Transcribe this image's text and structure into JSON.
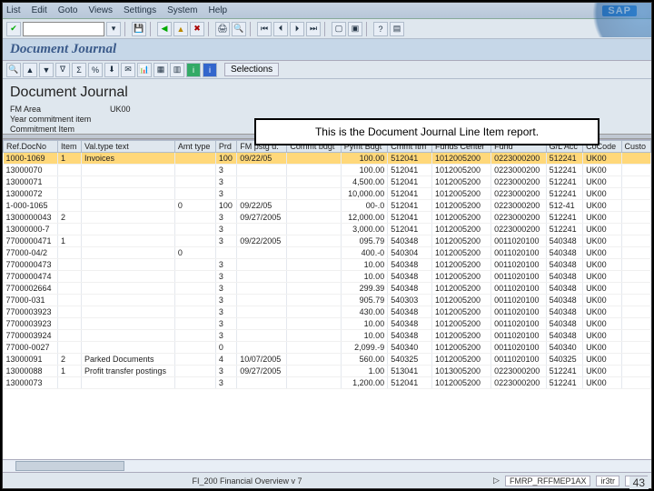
{
  "menu": [
    "List",
    "Edit",
    "Goto",
    "Views",
    "Settings",
    "System",
    "Help"
  ],
  "logo": "SAP",
  "transaction_input": "",
  "title": "Document Journal",
  "page_heading": "Document Journal",
  "header": {
    "fm_area_label": "FM Area",
    "fm_area_value": "UK00",
    "yci_label": "Year commitment item",
    "ci_label": "Commitment Item"
  },
  "callout_text": "This is the Document Journal Line Item report.",
  "selections_btn": "Selections",
  "columns": [
    "Ref.DocNo",
    "Item",
    "Val.type text",
    "Amt type",
    "Prd",
    "FM pstg d.",
    "Commt bdgt",
    "Pymt Bdgt",
    "Cmmt Itm",
    "Funds Center",
    "Fund",
    "G/L Acc",
    "CoCode",
    "Custo"
  ],
  "rows": [
    {
      "sel": true,
      "c": [
        "1000-1069",
        "1",
        "Invoices",
        "",
        "100",
        "09/22/05",
        "",
        "100.00",
        "512041",
        "1012005200",
        "0223000200",
        "512241",
        "UK00",
        ""
      ]
    },
    {
      "c": [
        "13000070",
        "",
        "",
        "",
        "3",
        "",
        "",
        "100.00",
        "512041",
        "1012005200",
        "0223000200",
        "512241",
        "UK00",
        ""
      ]
    },
    {
      "c": [
        "13000071",
        "",
        "",
        "",
        "3",
        "",
        "",
        "4,500.00",
        "512041",
        "1012005200",
        "0223000200",
        "512241",
        "UK00",
        ""
      ]
    },
    {
      "c": [
        "13000072",
        "",
        "",
        "",
        "3",
        "",
        "",
        "10,000.00",
        "512041",
        "1012005200",
        "0223000200",
        "512241",
        "UK00",
        ""
      ]
    },
    {
      "c": [
        "1-000-1065",
        "",
        "",
        "0",
        "100",
        "09/22/05",
        "",
        "00-.0",
        "512041",
        "1012005200",
        "0223000200",
        "512-41",
        "UK00",
        ""
      ]
    },
    {
      "c": [
        "1300000043",
        "2",
        "",
        "",
        "3",
        "09/27/2005",
        "",
        "12,000.00",
        "512041",
        "1012005200",
        "0223000200",
        "512241",
        "UK00",
        ""
      ]
    },
    {
      "c": [
        "13000000-7",
        "",
        "",
        "",
        "3",
        "",
        "",
        "3,000.00",
        "512041",
        "1012005200",
        "0223000200",
        "512241",
        "UK00",
        ""
      ]
    },
    {
      "c": [
        "7700000471",
        "1",
        "",
        "",
        "3",
        "09/22/2005",
        "",
        "095.79",
        "540348",
        "1012005200",
        "0011020100",
        "540348",
        "UK00",
        ""
      ]
    },
    {
      "c": [
        "77000-04/2",
        "",
        "",
        "0",
        "",
        "",
        "",
        "400.-0",
        "540304",
        "1012005200",
        "0011020100",
        "540348",
        "UK00",
        ""
      ]
    },
    {
      "c": [
        "7700000473",
        "",
        "",
        "",
        "3",
        "",
        "",
        "10.00",
        "540348",
        "1012005200",
        "0011020100",
        "540348",
        "UK00",
        ""
      ]
    },
    {
      "c": [
        "7700000474",
        "",
        "",
        "",
        "3",
        "",
        "",
        "10.00",
        "540348",
        "1012005200",
        "0011020100",
        "540348",
        "UK00",
        ""
      ]
    },
    {
      "c": [
        "7700002664",
        "",
        "",
        "",
        "3",
        "",
        "",
        "299.39",
        "540348",
        "1012005200",
        "0011020100",
        "540348",
        "UK00",
        ""
      ]
    },
    {
      "c": [
        "77000-031",
        "",
        "",
        "",
        "3",
        "",
        "",
        "905.79",
        "540303",
        "1012005200",
        "0011020100",
        "540348",
        "UK00",
        ""
      ]
    },
    {
      "c": [
        "7700003923",
        "",
        "",
        "",
        "3",
        "",
        "",
        "430.00",
        "540348",
        "1012005200",
        "0011020100",
        "540348",
        "UK00",
        ""
      ]
    },
    {
      "c": [
        "7700003923",
        "",
        "",
        "",
        "3",
        "",
        "",
        "10.00",
        "540348",
        "1012005200",
        "0011020100",
        "540348",
        "UK00",
        ""
      ]
    },
    {
      "c": [
        "7700003924",
        "",
        "",
        "",
        "3",
        "",
        "",
        "10.00",
        "540348",
        "1012005200",
        "0011020100",
        "540348",
        "UK00",
        ""
      ]
    },
    {
      "c": [
        "77000-0027",
        "",
        "",
        "",
        "0",
        "",
        "",
        "2,099.-9",
        "540340",
        "1012005200",
        "0011020100",
        "540340",
        "UK00",
        ""
      ]
    },
    {
      "c": [
        "13000091",
        "2",
        "Parked Documents",
        "",
        "4",
        "10/07/2005",
        "",
        "560.00",
        "540325",
        "1012005200",
        "0011020100",
        "540325",
        "UK00",
        ""
      ]
    },
    {
      "c": [
        "13000088",
        "1",
        "Profit transfer postings",
        "",
        "3",
        "09/27/2005",
        "",
        "1.00",
        "513041",
        "1013005200",
        "0223000200",
        "512241",
        "UK00",
        ""
      ]
    },
    {
      "c": [
        "13000073",
        "",
        "",
        "",
        "3",
        "",
        "",
        "1,200.00",
        "512041",
        "1012005200",
        "0223000200",
        "512241",
        "UK00",
        ""
      ]
    }
  ],
  "status": {
    "center": "FI_200 Financial Overview v 7",
    "right1": "FMRP_RFFMEP1AX",
    "right2": "ir3tr",
    "right3": "INS"
  },
  "slide_num": "43"
}
